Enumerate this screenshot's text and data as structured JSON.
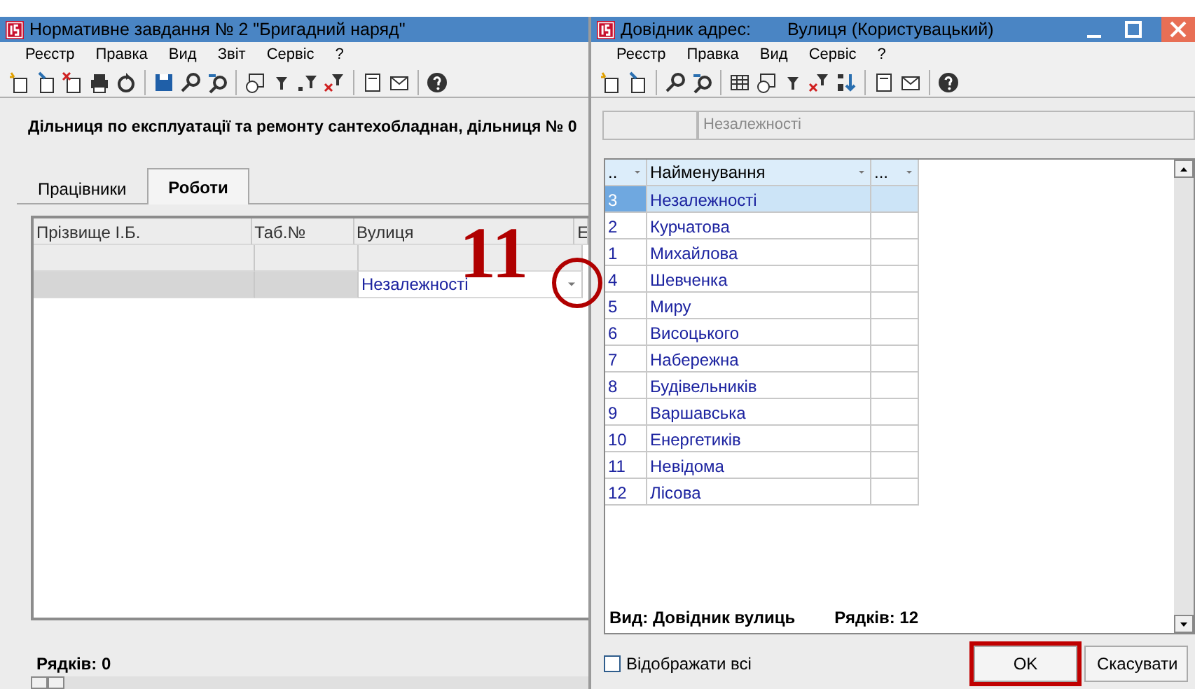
{
  "left_window": {
    "title": "Нормативне завдання № 2 \"Бригадний наряд\"",
    "menu": [
      "Реєстр",
      "Правка",
      "Вид",
      "Звіт",
      "Сервіс",
      "?"
    ],
    "heading": "Дільниця по експлуатації та ремонту сантехобладнан, дільниця № 0",
    "tabs": [
      {
        "label": "Працівники",
        "selected": false
      },
      {
        "label": "Роботи",
        "selected": true
      }
    ],
    "table": {
      "columns": [
        "Прізвище І.Б.",
        "Таб.№",
        "Вулиця",
        "Е"
      ],
      "rows": [
        {
          "selected": false
        },
        {
          "selected": true,
          "street": "Незалежності"
        }
      ]
    },
    "status": "Рядків: 0"
  },
  "right_window": {
    "title": "Довідник адрес:",
    "subtitle": "Вулиця (Користувацький)",
    "menu": [
      "Реєстр",
      "Правка",
      "Вид",
      "Сервіс",
      "?"
    ],
    "filter_value": "Незалежності",
    "table": {
      "columns": [
        "..",
        "Найменування",
        "..."
      ],
      "rows": [
        {
          "code": "3",
          "name": "Незалежності",
          "selected": true
        },
        {
          "code": "2",
          "name": "Курчатова",
          "selected": false
        },
        {
          "code": "1",
          "name": "Михайлова",
          "selected": false
        },
        {
          "code": "4",
          "name": "Шевченка",
          "selected": false
        },
        {
          "code": "5",
          "name": "Миру",
          "selected": false
        },
        {
          "code": "6",
          "name": "Висоцького",
          "selected": false
        },
        {
          "code": "7",
          "name": "Набережна",
          "selected": false
        },
        {
          "code": "8",
          "name": "Будівельників",
          "selected": false
        },
        {
          "code": "9",
          "name": "Варшавська",
          "selected": false
        },
        {
          "code": "10",
          "name": "Енергетиків",
          "selected": false
        },
        {
          "code": "11",
          "name": "Невідома",
          "selected": false
        },
        {
          "code": "12",
          "name": "Лісова",
          "selected": false
        }
      ]
    },
    "view": "Вид: Довідник вулиць",
    "row_count": "Рядків: 12",
    "show_all": {
      "label": "Відображати всі",
      "checked": false
    },
    "buttons": [
      {
        "label": "OK",
        "highlighted": true
      },
      {
        "label": "Скасувати",
        "highlighted": false
      }
    ]
  },
  "annotation": {
    "label": "11"
  }
}
